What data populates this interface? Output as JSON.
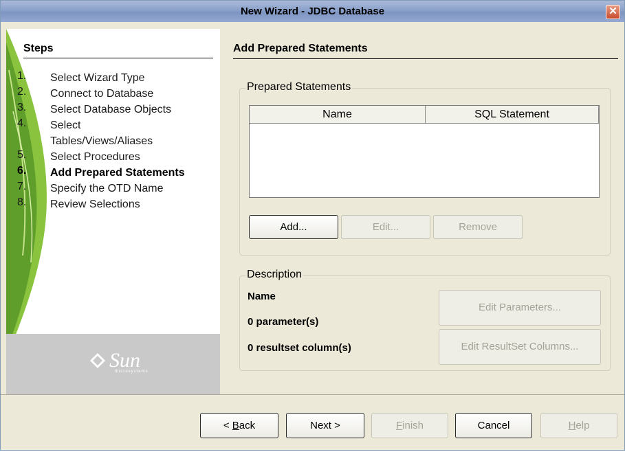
{
  "window": {
    "title": "New Wizard - JDBC Database",
    "close_icon": "close-icon"
  },
  "steps": {
    "heading": "Steps",
    "items": [
      {
        "num": "1.",
        "label": "Select Wizard Type"
      },
      {
        "num": "2.",
        "label": "Connect to Database"
      },
      {
        "num": "3.",
        "label": "Select Database Objects"
      },
      {
        "num": "4.",
        "label": "Select Tables/Views/Aliases"
      },
      {
        "num": "5.",
        "label": "Select Procedures"
      },
      {
        "num": "6.",
        "label": "Add Prepared Statements"
      },
      {
        "num": "7.",
        "label": "Specify the OTD Name"
      },
      {
        "num": "8.",
        "label": "Review Selections"
      }
    ],
    "current_index": 5
  },
  "logo": {
    "word": "Sun",
    "sub": "microsystems"
  },
  "main": {
    "heading": "Add Prepared Statements",
    "prepared": {
      "legend": "Prepared Statements",
      "columns": [
        "Name",
        "SQL Statement"
      ],
      "rows": [],
      "add_label": "Add...",
      "edit_label": "Edit...",
      "remove_label": "Remove"
    },
    "description": {
      "legend": "Description",
      "name_label": "Name",
      "params_label": "0 parameter(s)",
      "resultset_label": "0 resultset column(s)",
      "edit_params_label": "Edit Parameters...",
      "edit_resultset_label": "Edit ResultSet Columns..."
    }
  },
  "footer": {
    "back": {
      "mnemonic": "B",
      "rest": "ack",
      "prefix": "< "
    },
    "next": "Next >",
    "finish": {
      "mnemonic": "F",
      "rest": "inish"
    },
    "cancel": "Cancel",
    "help": {
      "mnemonic": "H",
      "rest": "elp"
    }
  },
  "colors": {
    "title_bar": "#8ba1cb",
    "leaf_green": "#8ac43f",
    "dialog_bg": "#ece9d8",
    "logo_bg": "#c9c9c9"
  }
}
